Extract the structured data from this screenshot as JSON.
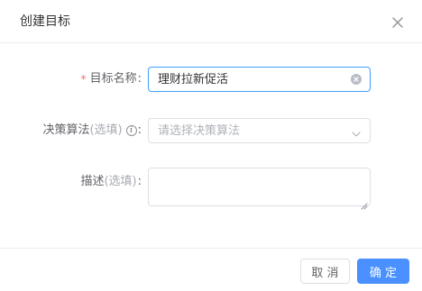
{
  "dialog": {
    "title": "创建目标",
    "close_icon": "close-icon"
  },
  "form": {
    "name": {
      "required_mark": "*",
      "label": "目标名称",
      "colon": ":",
      "value": "理财拉新促活",
      "clear_icon": "clear-circle-icon"
    },
    "algorithm": {
      "label": "决策算法",
      "optional": "(选填)",
      "info_icon": "info-circle-icon",
      "info_glyph": "i",
      "colon": ":",
      "placeholder": "请选择决策算法",
      "dropdown_icon": "chevron-down-icon"
    },
    "description": {
      "label": "描述",
      "optional": "(选填)",
      "colon": ":",
      "value": ""
    }
  },
  "footer": {
    "cancel_label": "取 消",
    "confirm_label": "确 定"
  },
  "colors": {
    "primary": "#4a90ff",
    "focus_border": "#409eff",
    "required": "#f56c6c"
  }
}
